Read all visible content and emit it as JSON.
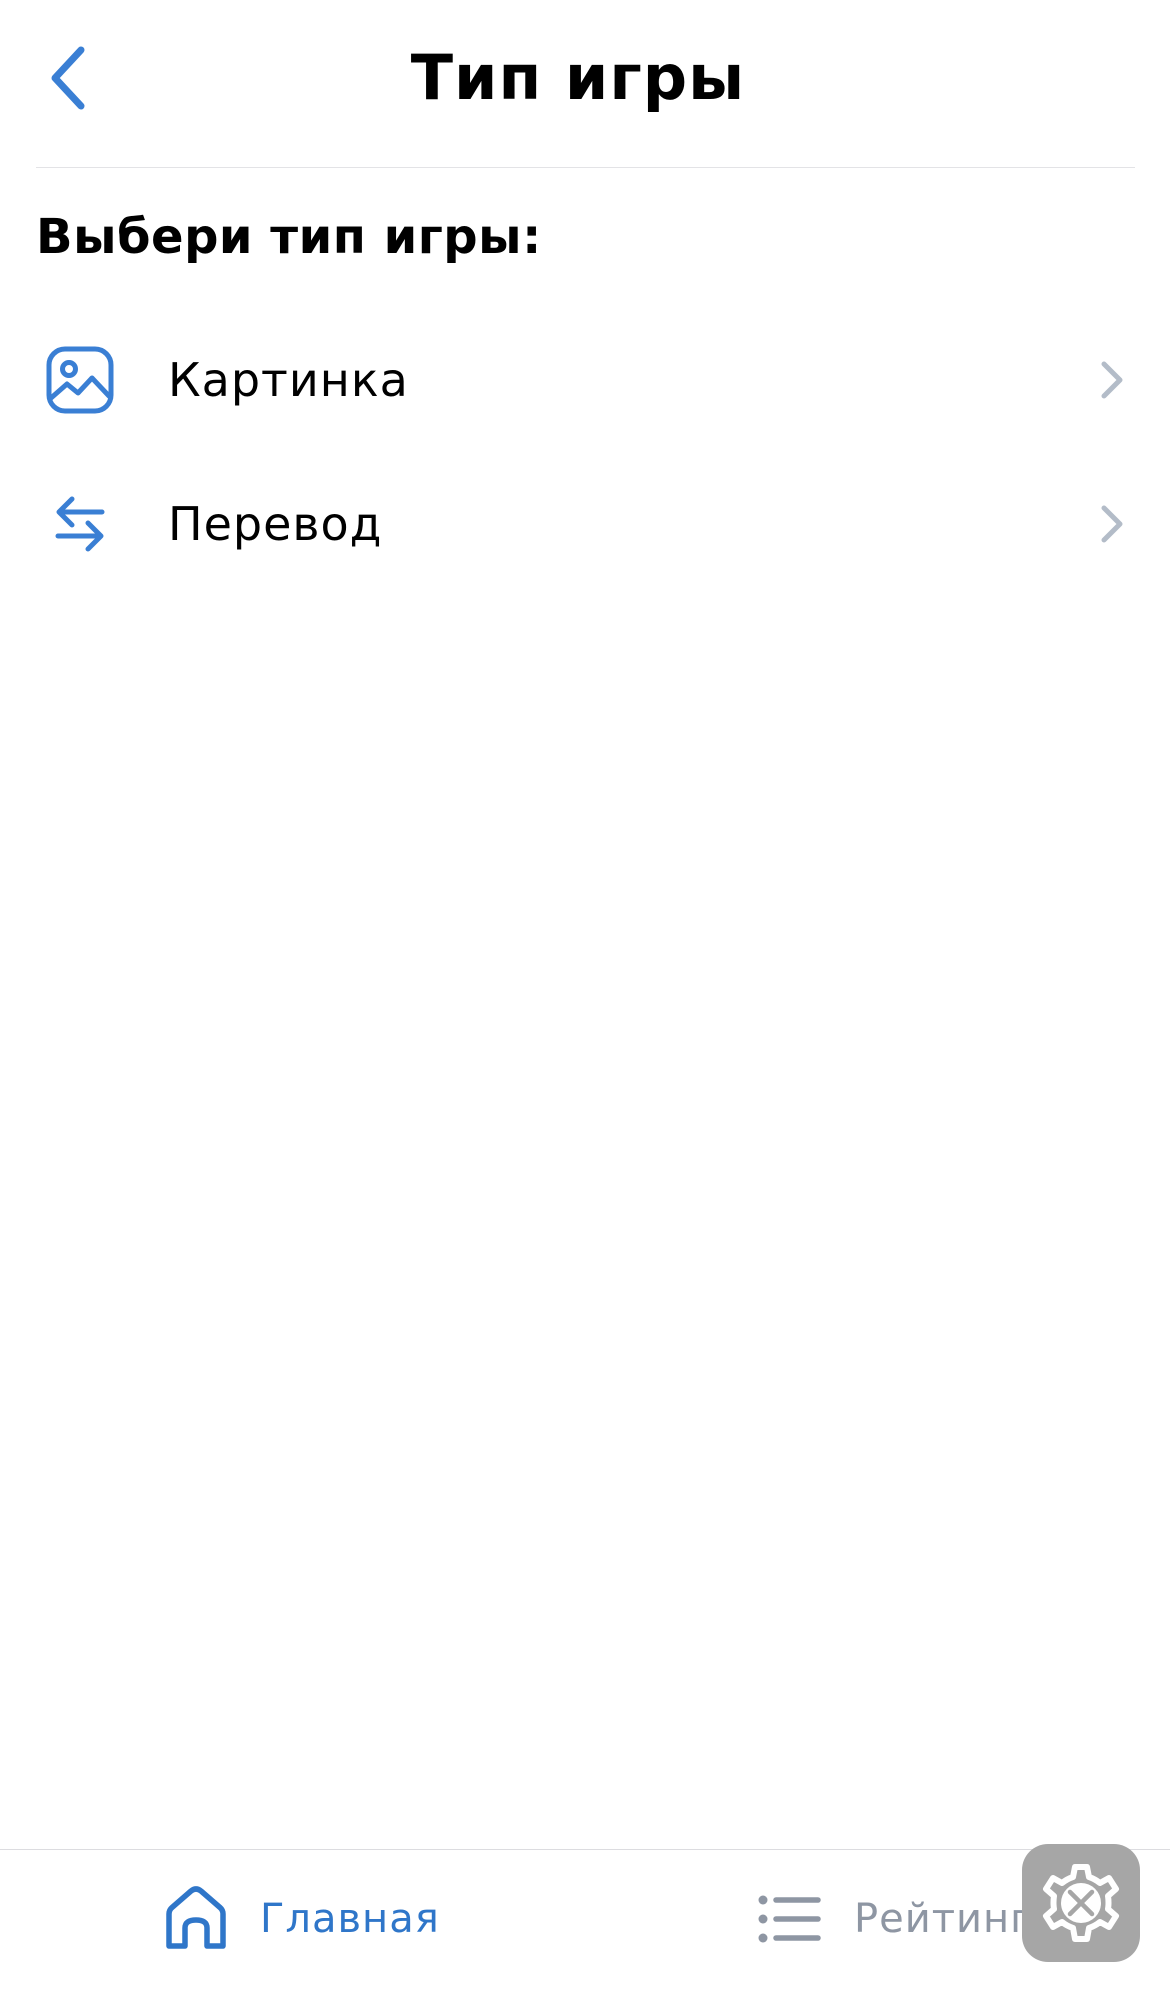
{
  "header": {
    "title": "Тип игры",
    "back_icon": "chevron-left-icon"
  },
  "section": {
    "heading": "Выбери тип игры:"
  },
  "game_types": [
    {
      "label": "Картинка",
      "icon": "image-icon"
    },
    {
      "label": "Перевод",
      "icon": "swap-arrows-icon"
    }
  ],
  "tabbar": {
    "tabs": [
      {
        "label": "Главная",
        "icon": "home-icon",
        "active": true
      },
      {
        "label": "Рейтинг",
        "icon": "list-icon",
        "active": false
      }
    ]
  },
  "fab": {
    "icon": "settings-tools-icon"
  },
  "colors": {
    "accent": "#2f76c9",
    "icon_blue": "#3a7fd4",
    "chevron": "#b3bcc8",
    "inactive_tab": "#8e96a3",
    "fab_background": "#a6a6a6"
  }
}
